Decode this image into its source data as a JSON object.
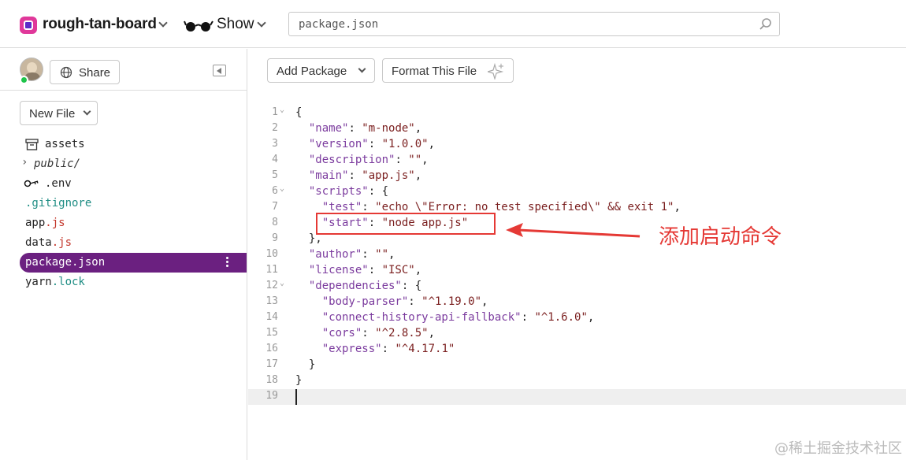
{
  "header": {
    "project_name": "rough-tan-board",
    "show_label": "Show",
    "search_value": "package.json"
  },
  "sidebar": {
    "share_label": "Share",
    "new_file_label": "New File",
    "files": [
      {
        "prefix": "",
        "label": "assets",
        "ext": "",
        "icon": "archive-icon",
        "style": "normal"
      },
      {
        "prefix": "",
        "label": "public/",
        "ext": "",
        "icon": "chevron-right-icon",
        "style": "folder"
      },
      {
        "prefix": "",
        "label": ".env",
        "ext": "",
        "icon": "key-icon",
        "style": "normal"
      },
      {
        "prefix": "",
        "label": ".gitignore",
        "ext": "",
        "icon": "",
        "style": "green"
      },
      {
        "prefix": "app",
        "label": "app",
        "ext": ".js",
        "icon": "",
        "style": "red-ext"
      },
      {
        "prefix": "data",
        "label": "data",
        "ext": ".js",
        "icon": "",
        "style": "red-ext"
      },
      {
        "prefix": "",
        "label": "package.json",
        "ext": "",
        "icon": "",
        "style": "active"
      },
      {
        "prefix": "yarn",
        "label": "yarn",
        "ext": ".lock",
        "icon": "",
        "style": "green-ext"
      }
    ]
  },
  "toolbar": {
    "add_package_label": "Add Package",
    "format_label": "Format This File"
  },
  "editor": {
    "lines": [
      "{",
      "  \"name\": \"m-node\",",
      "  \"version\": \"1.0.0\",",
      "  \"description\": \"\",",
      "  \"main\": \"app.js\",",
      "  \"scripts\": {",
      "    \"test\": \"echo \\\"Error: no test specified\\\" && exit 1\",",
      "    \"start\": \"node app.js\"",
      "  },",
      "  \"author\": \"\",",
      "  \"license\": \"ISC\",",
      "  \"dependencies\": {",
      "    \"body-parser\": \"^1.19.0\",",
      "    \"connect-history-api-fallback\": \"^1.6.0\",",
      "    \"cors\": \"^2.8.5\",",
      "    \"express\": \"^4.17.1\"",
      "  }",
      "}",
      ""
    ],
    "fold_lines": [
      1,
      6,
      12
    ],
    "current_line": 19
  },
  "annotation": {
    "text": "添加启动命令",
    "color": "#e53935"
  },
  "watermark": "@稀土掘金技术社区",
  "colors": {
    "active_file_bg": "#6b2080",
    "json_key": "#7b3b9e",
    "json_string": "#7a1e1e"
  }
}
